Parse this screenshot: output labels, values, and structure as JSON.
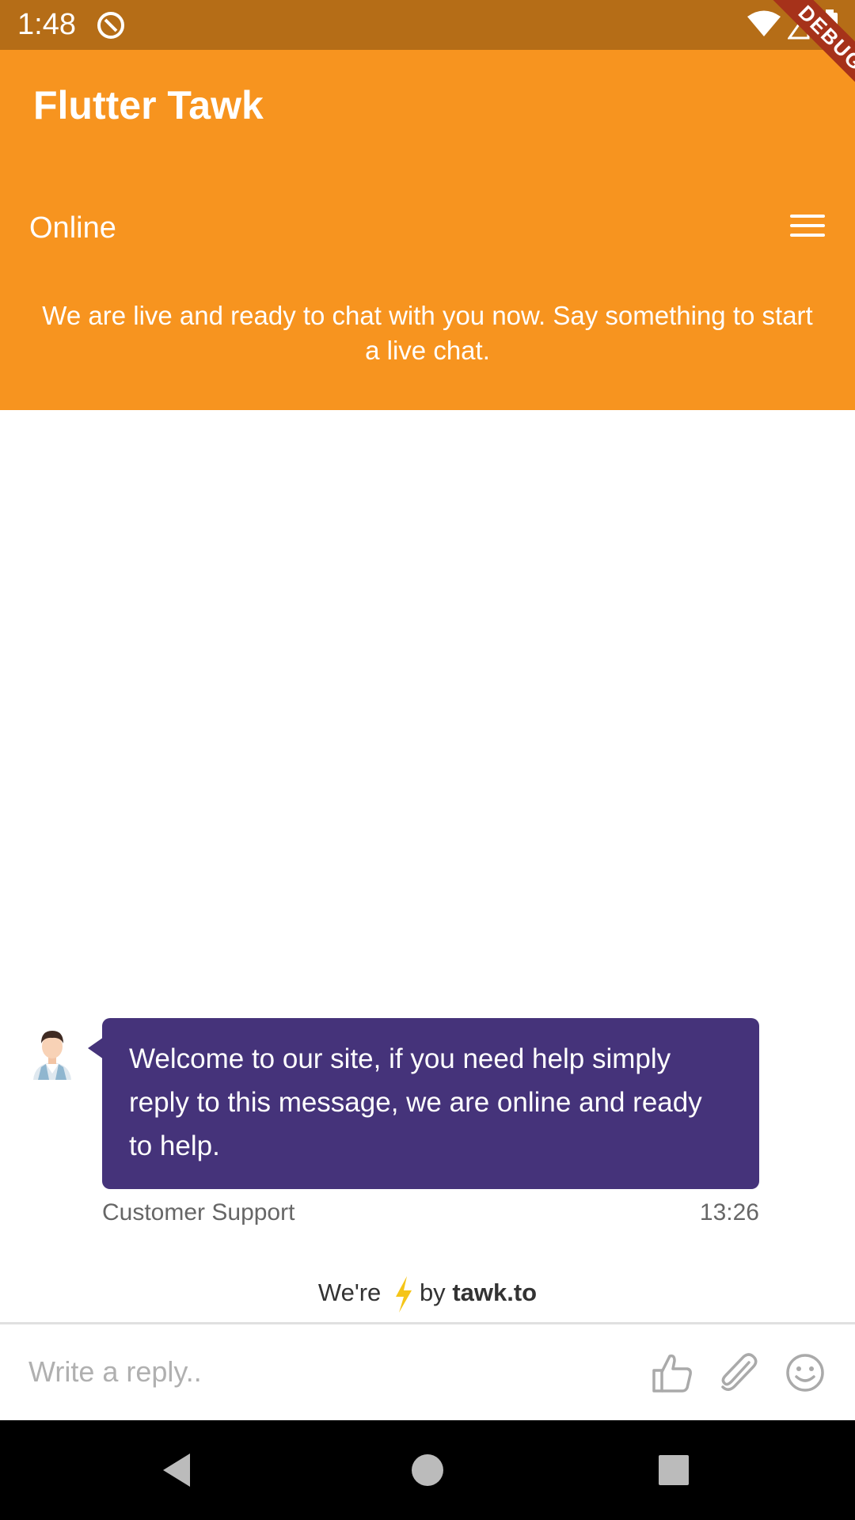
{
  "status_bar": {
    "time": "1:48",
    "debug_label": "DEBUG",
    "icons": [
      "app-notification-icon",
      "wifi-icon",
      "signal-icon",
      "battery-icon"
    ]
  },
  "app_bar": {
    "title": "Flutter Tawk",
    "chat_status": "Online",
    "status_message": "We are live and ready to chat with you now. Say something to start a live chat.",
    "menu_icon": "hamburger-menu-icon",
    "background_color": "#f7941f"
  },
  "messages": [
    {
      "text": "Welcome to our site, if you need help simply reply to this message, we are online and ready to help.",
      "sender": "Customer Support",
      "time": "13:26",
      "avatar_icon": "agent-avatar-icon",
      "bubble_color": "#45337a"
    }
  ],
  "branding": {
    "prefix": "We're",
    "icon": "lightning-bolt-icon",
    "by": "by",
    "brand": "tawk.to"
  },
  "composer": {
    "placeholder": "Write a reply..",
    "icons": [
      "thumbs-up-icon",
      "paperclip-icon",
      "emoji-icon"
    ]
  },
  "nav_bar": {
    "icons": [
      "back-icon",
      "home-icon",
      "recents-icon"
    ]
  }
}
